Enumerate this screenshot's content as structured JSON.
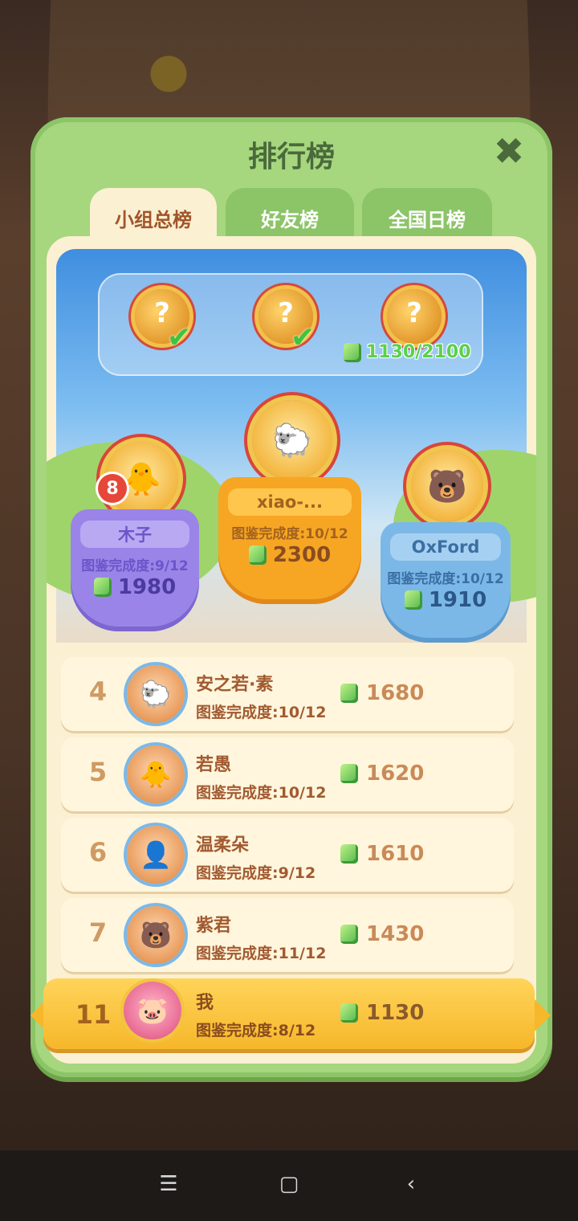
{
  "panel": {
    "title": "排行榜",
    "close_icon": "close-icon"
  },
  "tabs": [
    {
      "label": "小组总榜",
      "active": true
    },
    {
      "label": "好友榜",
      "active": false
    },
    {
      "label": "全国日榜",
      "active": false
    }
  ],
  "rewards": {
    "chests": [
      {
        "mark": "?",
        "claimed": true
      },
      {
        "mark": "?",
        "claimed": true
      },
      {
        "mark": "?",
        "claimed": false
      }
    ],
    "progress": "1130/2100"
  },
  "podium": {
    "first": {
      "name": "xiao-...",
      "completion": "图鉴完成度:10/12",
      "score": "2300"
    },
    "second": {
      "name": "木子",
      "completion": "图鉴完成度:9/12",
      "score": "1980",
      "badge": "8"
    },
    "third": {
      "name": "OxFord",
      "completion": "图鉴完成度:10/12",
      "score": "1910"
    }
  },
  "list": [
    {
      "rank": "4",
      "name": "安之若·素",
      "completion": "图鉴完成度:10/12",
      "score": "1680"
    },
    {
      "rank": "5",
      "name": "若愚",
      "completion": "图鉴完成度:10/12",
      "score": "1620"
    },
    {
      "rank": "6",
      "name": "温柔朵",
      "completion": "图鉴完成度:9/12",
      "score": "1610"
    },
    {
      "rank": "7",
      "name": "紫君",
      "completion": "图鉴完成度:11/12",
      "score": "1430"
    }
  ],
  "me": {
    "rank": "11",
    "name": "我",
    "completion": "图鉴完成度:8/12",
    "score": "1130"
  },
  "colors": {
    "panel": "#a6d67e",
    "gold": "#f6b72a",
    "gem": "#4fb548",
    "purple": "#9a84e8",
    "blue": "#7bb8e8"
  }
}
